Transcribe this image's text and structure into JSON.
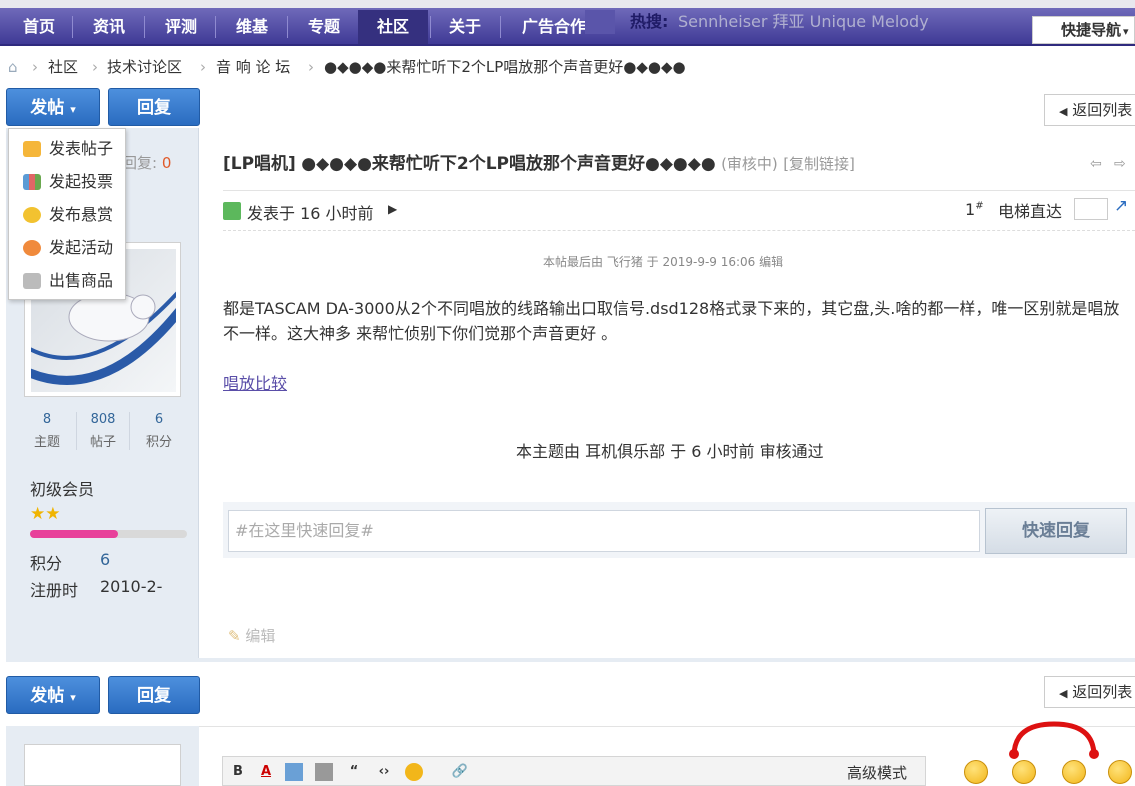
{
  "nav": {
    "items": [
      "首页",
      "资讯",
      "评测",
      "维基",
      "专题",
      "社区",
      "关于",
      "广告合作"
    ],
    "hot_label": "热搜:",
    "hot_terms": "Sennheiser  拜亚  Unique Melody",
    "quick_nav": "快捷导航"
  },
  "breadcrumb": {
    "items": [
      "社区",
      "技术讨论区",
      "音 响 论 坛",
      "●◆●◆●来帮忙听下2个LP唱放那个声音更好●◆●◆●"
    ]
  },
  "actions": {
    "post_label": "发帖",
    "reply_label": "回复",
    "back_label": "返回列表"
  },
  "post_menu": {
    "items": [
      "发表帖子",
      "发起投票",
      "发布悬赏",
      "发起活动",
      "出售商品"
    ]
  },
  "thread": {
    "replies_label": "回复:",
    "replies_count": "0",
    "category": "[LP唱机]",
    "title": "●◆●◆●来帮忙听下2个LP唱放那个声音更好●◆●◆●",
    "status": "(审核中)",
    "copy_link": "[复制链接]"
  },
  "post": {
    "posted_time": "发表于 16 小时前",
    "floor": "1",
    "floor_suffix": "#",
    "elevator_label": "电梯直达",
    "edit_note": "本帖最后由 飞行猪 于 2019-9-9 16:06 编辑",
    "body": "都是TASCAM DA-3000从2个不同唱放的线路输出口取信号.dsd128格式录下来的，其它盘,头.啥的都一样，唯一区别就是唱放不一样。这大神多 来帮忙侦别下你们觉那个声音更好 。",
    "link": "唱放比较",
    "moderation_note": "本主题由 耳机俱乐部 于 6 小时前 审核通过",
    "edit_label": "编辑"
  },
  "user": {
    "stats": [
      {
        "value": "8",
        "label": "主题"
      },
      {
        "value": "808",
        "label": "帖子"
      },
      {
        "value": "6",
        "label": "积分"
      }
    ],
    "rank": "初级会员",
    "points_label": "积分",
    "points_value": "6",
    "reg_label": "注册时",
    "reg_value": "2010-2-"
  },
  "quick_reply": {
    "placeholder": "#在这里快速回复#",
    "button": "快速回复"
  },
  "editor": {
    "advanced_mode": "高级模式"
  },
  "colors": {
    "nav_bg": "#4a44a3",
    "button_blue": "#2a6cc0",
    "reply_count": "#e05a2a",
    "progress": "#e8409a"
  }
}
